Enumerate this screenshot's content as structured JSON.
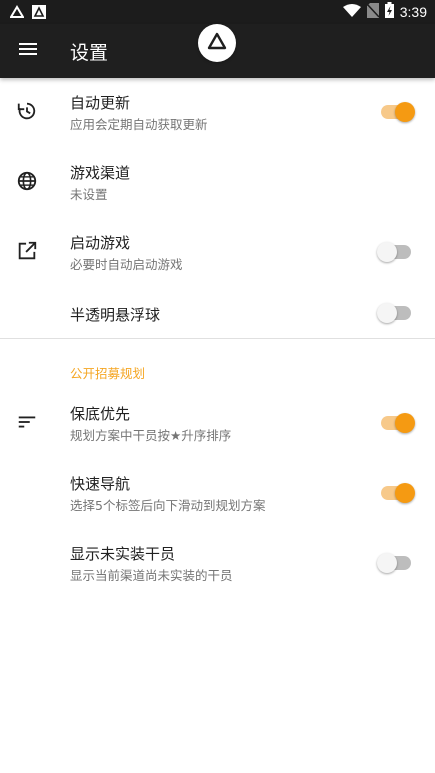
{
  "status_bar": {
    "time": "3:39",
    "left_icons": [
      "app-notification-icon",
      "app-notification-boxed-icon"
    ],
    "right_icons": [
      "wifi-icon",
      "no-sim-icon",
      "battery-charging-icon"
    ]
  },
  "app_bar": {
    "title": "设置",
    "menu_icon": "menu-icon",
    "logo_icon": "app-logo-icon"
  },
  "settings": [
    {
      "id": "auto-update",
      "icon": "update-history-icon",
      "title": "自动更新",
      "subtitle": "应用会定期自动获取更新",
      "toggle": true
    },
    {
      "id": "game-channel",
      "icon": "globe-icon",
      "title": "游戏渠道",
      "subtitle": "未设置",
      "toggle": null
    },
    {
      "id": "launch-game",
      "icon": "open-external-icon",
      "title": "启动游戏",
      "subtitle": "必要时自动启动游戏",
      "toggle": false
    },
    {
      "id": "translucent-float",
      "icon": null,
      "title": "半透明悬浮球",
      "subtitle": "",
      "toggle": false
    }
  ],
  "section": {
    "header": "公开招募规划",
    "items": [
      {
        "id": "guarantee-priority",
        "icon": "sort-icon",
        "title": "保底优先",
        "subtitle": "规划方案中干员按★升序排序",
        "toggle": true
      },
      {
        "id": "quick-nav",
        "icon": null,
        "title": "快速导航",
        "subtitle": "选择5个标签后向下滑动到规划方案",
        "toggle": true
      },
      {
        "id": "show-unreleased",
        "icon": null,
        "title": "显示未实装干员",
        "subtitle": "显示当前渠道尚未实装的干员",
        "toggle": false
      }
    ]
  },
  "colors": {
    "accent": "#f59a12",
    "accent_track": "#f7c98a",
    "section_header": "#f5a623",
    "app_bar": "#1f1f1f",
    "status_bar": "#1c1c1c"
  }
}
